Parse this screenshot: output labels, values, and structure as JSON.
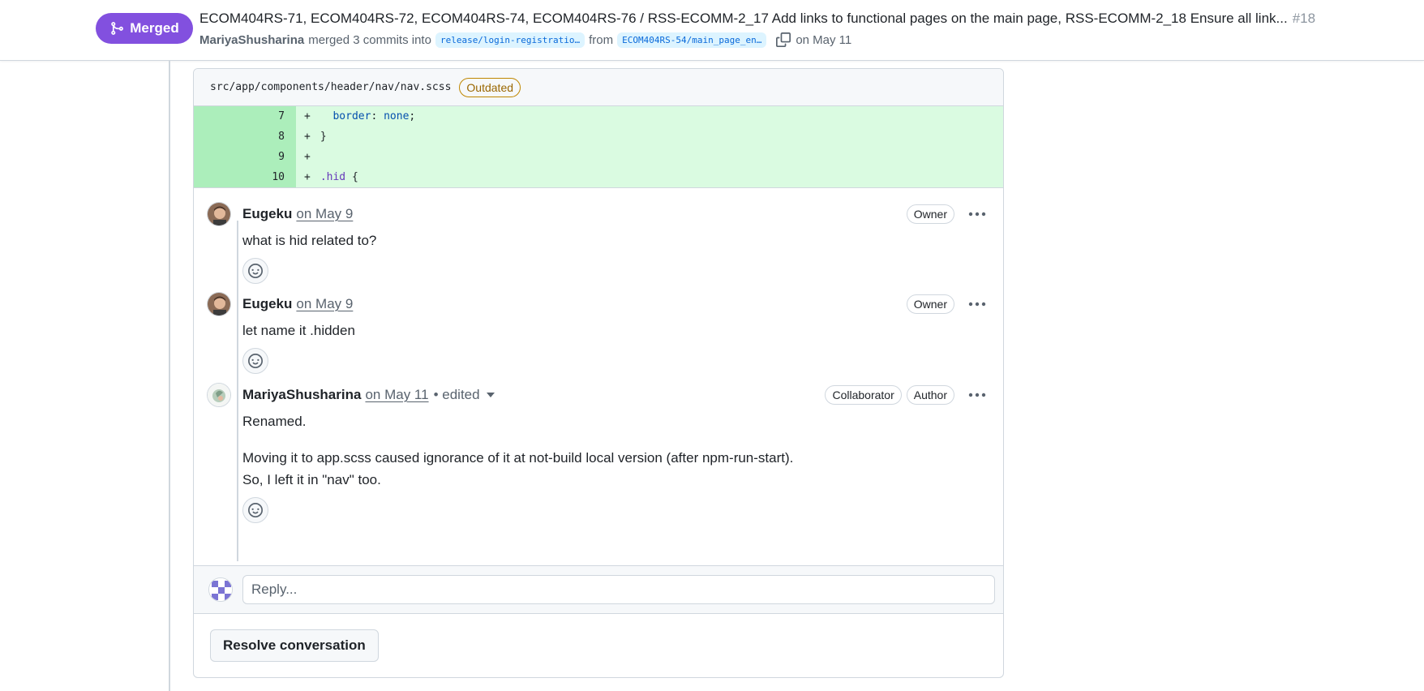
{
  "header": {
    "status": "Merged",
    "title": "ECOM404RS-71, ECOM404RS-72, ECOM404RS-74, ECOM404RS-76 / RSS-ECOMM-2_17 Add links to functional pages on the main page, RSS-ECOMM-2_18 Ensure all link...",
    "number": "#18",
    "author": "MariyaShusharina",
    "action": "merged 3 commits into",
    "base_branch": "release/login-registratio…",
    "from_word": "from",
    "head_branch": "ECOM404RS-54/main_page_en…",
    "date": "on May 11",
    "colors": {
      "merged": "#8250df",
      "branch_bg": "#ddf4ff",
      "branch_fg": "#0969da"
    }
  },
  "file": {
    "path": "src/app/components/header/nav/nav.scss",
    "label": "Outdated"
  },
  "diff": [
    {
      "num": "7",
      "sign": "+",
      "indent": "  ",
      "prop": "border",
      "sep": ": ",
      "val": "none",
      "end": ";"
    },
    {
      "num": "8",
      "sign": "+",
      "indent": "",
      "prop": "",
      "sep": "",
      "val": "",
      "end": "}"
    },
    {
      "num": "9",
      "sign": "+",
      "indent": "",
      "prop": "",
      "sep": "",
      "val": "",
      "end": ""
    },
    {
      "num": "10",
      "sign": "+",
      "indent": "",
      "prop": ".hid",
      "sep": " ",
      "val": "",
      "end": "{"
    }
  ],
  "comments": [
    {
      "author": "Eugeku",
      "date": "on May 9",
      "roles": [
        "Owner"
      ],
      "body": [
        "what is hid related to?"
      ]
    },
    {
      "author": "Eugeku",
      "date": "on May 9",
      "roles": [
        "Owner"
      ],
      "body": [
        "let name it .hidden"
      ]
    },
    {
      "author": "MariyaShusharina",
      "date": "on May 11",
      "edited": "• edited",
      "roles": [
        "Collaborator",
        "Author"
      ],
      "body": [
        "Renamed.",
        "Moving it to app.scss caused ignorance of it at not-build local version (after npm-run-start).",
        "So, I left it in \"nav\" too."
      ]
    }
  ],
  "reply": {
    "placeholder": "Reply..."
  },
  "resolve": {
    "label": "Resolve conversation"
  },
  "icons": {
    "merge": "git-merge-icon",
    "copy": "copy-icon",
    "kebab": "kebab-horizontal-icon",
    "reaction": "smiley-icon",
    "caret": "triangle-down-icon"
  }
}
